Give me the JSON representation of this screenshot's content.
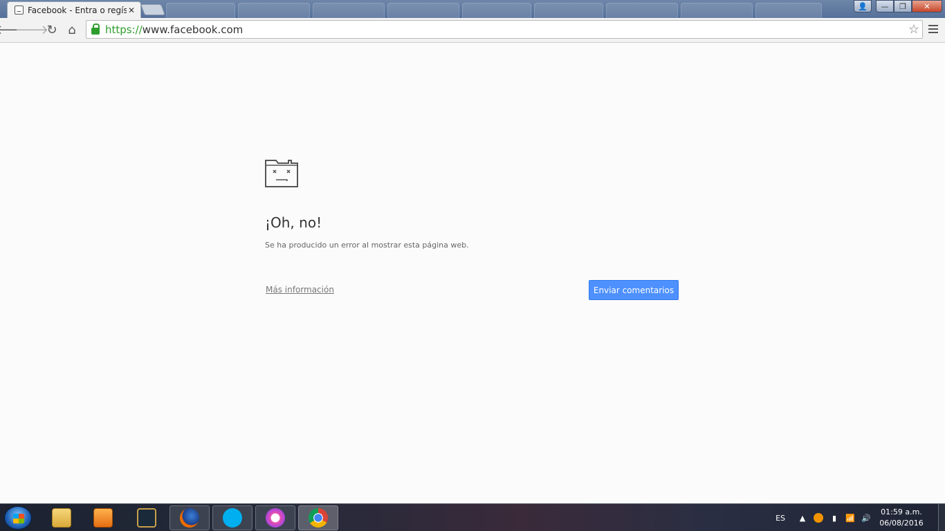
{
  "browser": {
    "active_tab": {
      "title": "Facebook - Entra o regístr",
      "close": "✕"
    },
    "url": {
      "scheme": "https://",
      "host": "www.facebook.com"
    },
    "window_controls": {
      "minimize": "—",
      "maximize": "❐",
      "close": "✕"
    }
  },
  "page": {
    "title": "¡Oh, no!",
    "description": "Se ha producido un error al mostrar esta página web.",
    "more_info": "Más información",
    "send_feedback": "Enviar comentarios"
  },
  "taskbar": {
    "language": "ES",
    "time": "01:59 a.m.",
    "date": "06/08/2016"
  },
  "colors": {
    "accent_button": "#4d90fe",
    "secure_green": "#2e9d2e"
  }
}
